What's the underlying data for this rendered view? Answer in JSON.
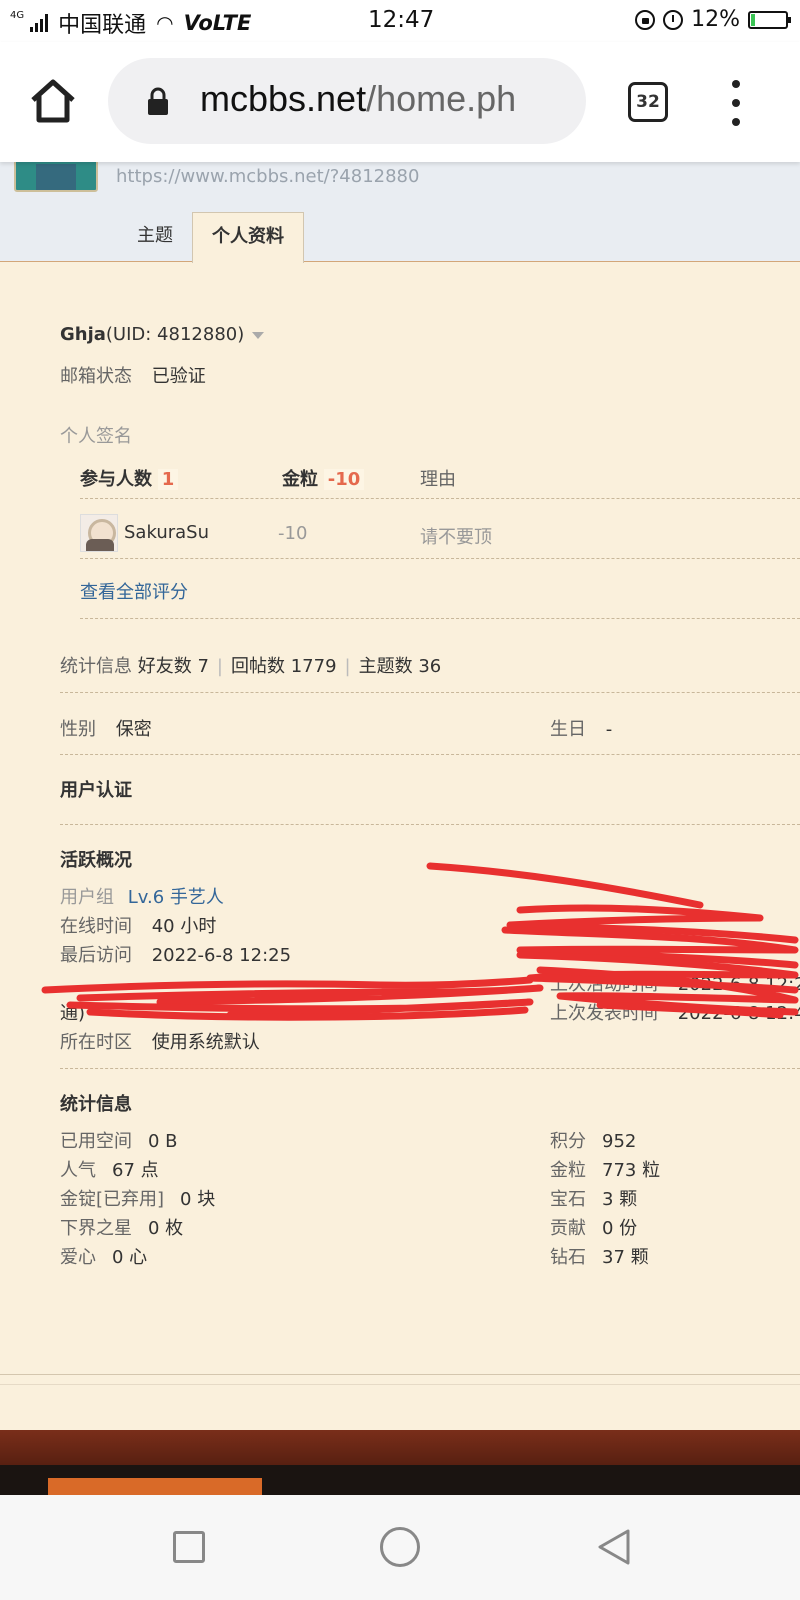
{
  "status_bar": {
    "signal_label": "4G",
    "carrier": "中国联通",
    "network": "VoLTE",
    "time": "12:47",
    "battery": "12%",
    "battery_level": 0.12
  },
  "browser": {
    "url_domain": "mcbbs.net",
    "url_path": "/home.ph",
    "tab_count": "32"
  },
  "profile": {
    "space_url": "https://www.mcbbs.net/?4812880",
    "tabs": [
      "主题",
      "个人资料"
    ],
    "name": "Ghja",
    "uid": "(UID: 4812880)",
    "email_label": "邮箱状态",
    "email_value": "已验证",
    "signature_label": "个人签名",
    "rating": {
      "participants_label": "参与人数",
      "participants": "1",
      "gold_label": "金粒",
      "gold_value": "-10",
      "reason_label": "理由",
      "entry_user": "SakuraSu",
      "entry_value": "-10",
      "entry_reason": "请不要顶",
      "view_all": "查看全部评分"
    },
    "stats_line": {
      "label": "统计信息",
      "friends": "好友数 7",
      "replies": "回帖数 1779",
      "threads": "主题数 36"
    },
    "gender_label": "性别",
    "gender_value": "保密",
    "birthday_label": "生日",
    "birthday_value": "-",
    "verification_title": "用户认证",
    "activity": {
      "title": "活跃概况",
      "group_label": "用户组",
      "group_value": "Lv.6 手艺人",
      "online_label": "在线时间",
      "online_value": "40 小时",
      "last_visit_label": "最后访问",
      "last_visit_value": "2022-6-8 12:25",
      "wrap_text": "通)",
      "last_activity_label": "上次活动时间",
      "last_activity_value": "2022-6-8 12:2",
      "last_post_label": "上次发表时间",
      "last_post_value": "2022-6-8 12:4",
      "timezone_label": "所在时区",
      "timezone_value": "使用系统默认"
    },
    "statistics": {
      "title": "统计信息",
      "left": [
        {
          "label": "已用空间",
          "value": "0 B"
        },
        {
          "label": "人气",
          "value": "67 点"
        },
        {
          "label": "金锭[已弃用]",
          "value": "0 块"
        },
        {
          "label": "下界之星",
          "value": "0 枚"
        },
        {
          "label": "爱心",
          "value": "0 心"
        }
      ],
      "right": [
        {
          "label": "积分",
          "value": "952"
        },
        {
          "label": "金粒",
          "value": "773 粒"
        },
        {
          "label": "宝石",
          "value": "3 颗"
        },
        {
          "label": "贡献",
          "value": "0 份"
        },
        {
          "label": "钻石",
          "value": "37 颗"
        }
      ]
    }
  },
  "colors": {
    "page_bg": "#faf0dc",
    "link": "#336699",
    "accent_red": "#e5694d",
    "scribble": "#e8302f"
  }
}
